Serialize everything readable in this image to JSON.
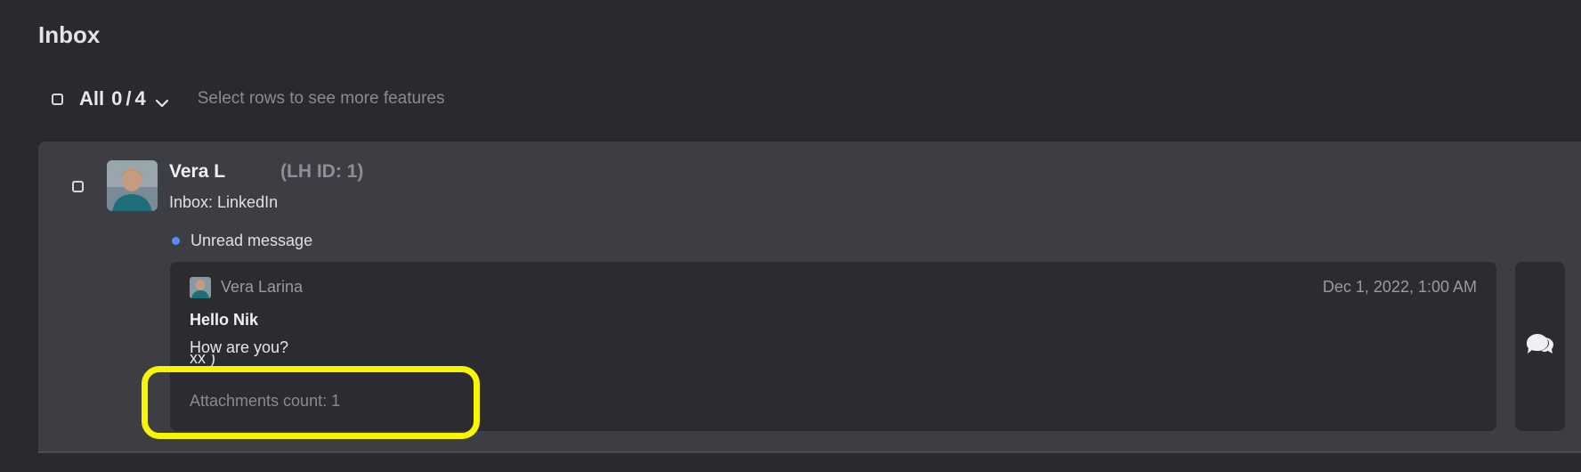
{
  "page": {
    "title": "Inbox"
  },
  "selection": {
    "all_label": "All",
    "selected_count": "0",
    "separator": "/",
    "total_count": "4",
    "hint": "Select rows to see more features"
  },
  "conversation": {
    "sender_name": "Vera L",
    "lh_id": "(LH ID: 1)",
    "inbox_label": "Inbox: LinkedIn",
    "unread_label": "Unread message",
    "message": {
      "author": "Vera Larina",
      "date": "Dec 1, 2022, 1:00 AM",
      "subject": "Hello Nik",
      "body": "How are you?",
      "body_extra": "xx )",
      "attachments": "Attachments count: 1"
    }
  },
  "icons": {
    "chevron": "chevron-down-icon",
    "chat": "chat-bubbles-icon"
  },
  "colors": {
    "background": "#2a2a2e",
    "card": "#3d3d44",
    "message": "#2b2b30",
    "unread_dot": "#5b8cff",
    "highlight": "#f7f500"
  }
}
